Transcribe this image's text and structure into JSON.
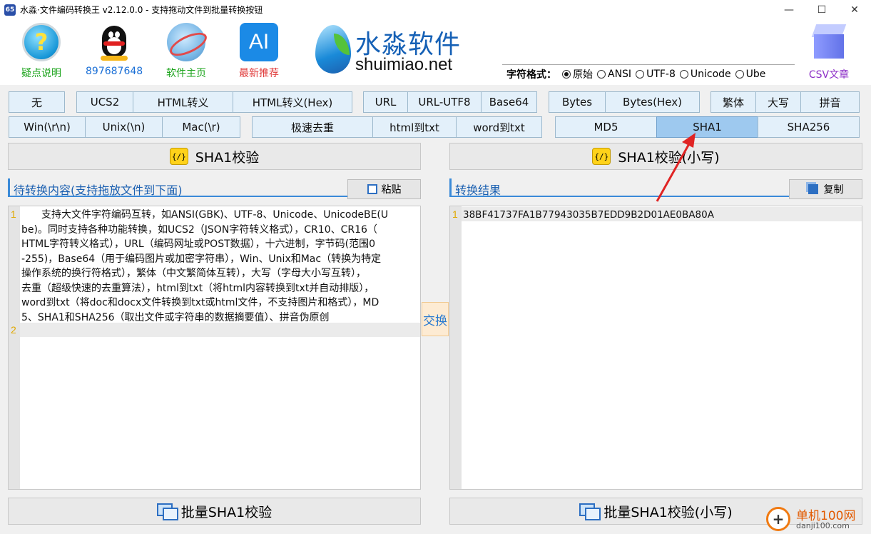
{
  "window": {
    "title": "水淼·文件编码转换王 v2.12.0.0 - 支持拖动文件到批量转换按钮",
    "icon_text": "65",
    "controls": {
      "minimize": "—",
      "maximize": "☐",
      "close": "✕"
    }
  },
  "header": {
    "help_label": "疑点说明",
    "help_icon": "?",
    "qq_label": "897687648",
    "home_label": "软件主页",
    "ai_label": "最新推荐",
    "ai_icon": "AI",
    "logo_cn": "水淼软件",
    "logo_en": "shuimiao.net",
    "csv_label": "CSV文章"
  },
  "char_format": {
    "label": "字符格式：",
    "options": [
      {
        "label": "原始",
        "selected": true
      },
      {
        "label": "ANSI",
        "selected": false
      },
      {
        "label": "UTF-8",
        "selected": false
      },
      {
        "label": "Unicode",
        "selected": false
      },
      {
        "label": "Ube",
        "selected": false
      }
    ]
  },
  "row1": {
    "none": "无",
    "ucs2": "UCS2",
    "html_escape": "HTML转义",
    "html_escape_hex": "HTML转义(Hex)",
    "url": "URL",
    "url_utf8": "URL-UTF8",
    "base64": "Base64",
    "bytes": "Bytes",
    "bytes_hex": "Bytes(Hex)",
    "traditional": "繁体",
    "uppercase": "大写",
    "pinyin": "拼音"
  },
  "row2": {
    "win": "Win(\\r\\n)",
    "unix": "Unix(\\n)",
    "mac": "Mac(\\r)",
    "dedupe": "极速去重",
    "html_to_txt": "html到txt",
    "word_to_txt": "word到txt",
    "md5": "MD5",
    "sha1": "SHA1",
    "sha256": "SHA256",
    "selected": "SHA1"
  },
  "left": {
    "action_label": "SHA1校验",
    "action_icon": "{/}",
    "header": "待转换内容(支持拖放文件到下面)",
    "paste_label": "粘贴",
    "line_numbers": [
      "1",
      "2"
    ],
    "lines": [
      "　　支持大文件字符编码互转，如ANSI(GBK)、UTF-8、Unicode、UnicodeBE(U",
      "be)。同时支持各种功能转换，如UCS2（JSON字符转义格式），CR10、CR16（",
      "HTML字符转义格式），URL（编码网址或POST数据），十六进制，字节码(范围0",
      "-255)，Base64（用于编码图片或加密字符串），Win、Unix和Mac（转换为特定",
      "操作系统的换行符格式），繁体（中文繁简体互转），大写（字母大小写互转），",
      "去重（超级快速的去重算法），html到txt（将html内容转换到txt并自动排版），",
      "word到txt（将doc和docx文件转换到txt或html文件，不支持图片和格式），MD",
      "5、SHA1和SHA256（取出文件或字符串的数据摘要值）、拼音伪原创"
    ],
    "batch_label": "批量SHA1校验"
  },
  "swap_label": "交换",
  "right": {
    "action_label": "SHA1校验(小写)",
    "action_icon": "{/}",
    "header": "转换结果",
    "copy_label": "复制",
    "line_numbers": [
      "1"
    ],
    "result": "38BF41737FA1B77943035B7EDD9B2D01AE0BA80A",
    "batch_label": "批量SHA1校验(小写)"
  },
  "watermark": {
    "cn": "单机100网",
    "en": "danji100.com",
    "icon": "+"
  },
  "colors": {
    "accent": "#3a8ad8",
    "selected_button": "#9ec9ef",
    "button": "#e3f0fa",
    "arrow": "#e02424"
  }
}
